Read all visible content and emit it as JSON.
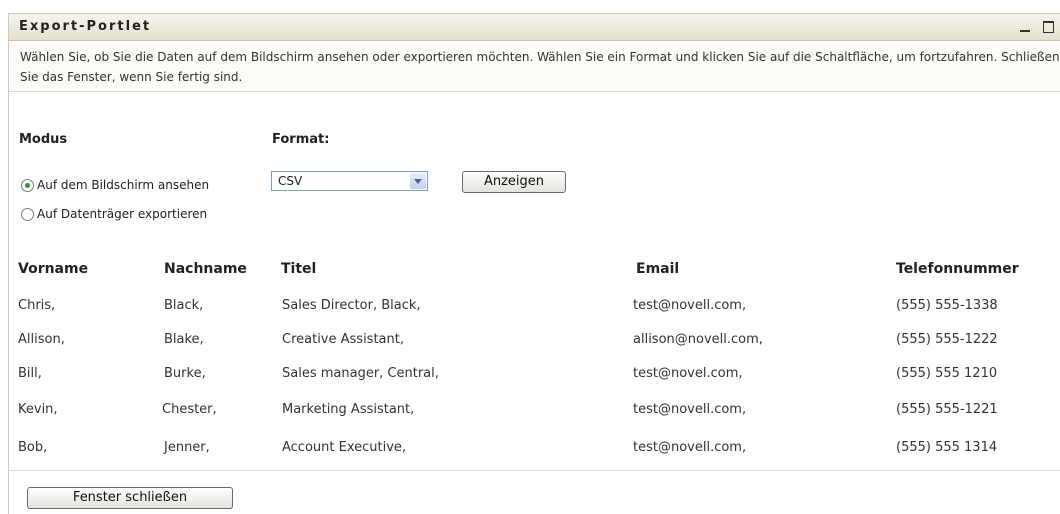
{
  "portlet": {
    "title": "Export-Portlet",
    "intro": "Wählen Sie, ob Sie die Daten auf dem Bildschirm ansehen oder exportieren möchten. Wählen Sie ein Format und klicken Sie auf die Schaltfläche, um fortzufahren. Schließen Sie das Fenster, wenn Sie fertig sind."
  },
  "mode": {
    "label": "Modus",
    "options": [
      {
        "label": "Auf dem Bildschirm ansehen",
        "checked": true
      },
      {
        "label": "Auf Datenträger exportieren",
        "checked": false
      }
    ]
  },
  "format": {
    "label": "Format:",
    "selected": "CSV",
    "button": "Anzeigen"
  },
  "table": {
    "headers": [
      "Vorname",
      "Nachname",
      "Titel",
      "Email",
      "Telefonnummer"
    ],
    "rows": [
      [
        "Chris,",
        "Black,",
        "Sales Director, Black,",
        "test@novell.com,",
        "(555) 555-1338"
      ],
      [
        "Allison,",
        "Blake,",
        "Creative Assistant,",
        "allison@novell.com,",
        "(555) 555-1222"
      ],
      [
        "Bill,",
        "Burke,",
        "Sales manager, Central,",
        "test@novel.com,",
        "(555) 555 1210"
      ],
      [
        "Kevin,",
        "Chester,",
        "Marketing Assistant,",
        "test@novell.com,",
        "(555) 555-1221"
      ],
      [
        "Bob,",
        "Jenner,",
        "Account Executive,",
        "test@novell.com,",
        "(555) 555 1314"
      ]
    ]
  },
  "footer": {
    "close_button": "Fenster schließen"
  }
}
